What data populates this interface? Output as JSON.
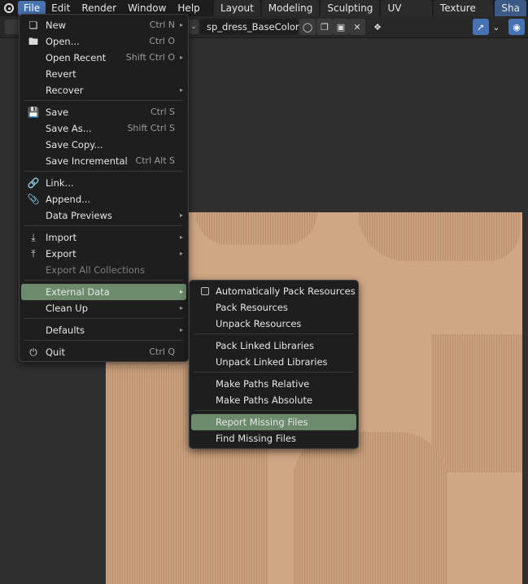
{
  "topbar": {
    "menus": [
      "File",
      "Edit",
      "Render",
      "Window",
      "Help"
    ],
    "workspaces": [
      "Layout",
      "Modeling",
      "Sculpting",
      "UV Editing",
      "Texture Paint",
      "Sha"
    ]
  },
  "header": {
    "image_name": "sp_dress_BaseColor"
  },
  "file_menu": {
    "new": {
      "label": "New",
      "shortcut": "Ctrl N"
    },
    "open": {
      "label": "Open...",
      "shortcut": "Ctrl O"
    },
    "open_recent": {
      "label": "Open Recent",
      "shortcut": "Shift Ctrl O"
    },
    "revert": {
      "label": "Revert"
    },
    "recover": {
      "label": "Recover"
    },
    "save": {
      "label": "Save",
      "shortcut": "Ctrl S"
    },
    "save_as": {
      "label": "Save As...",
      "shortcut": "Shift Ctrl S"
    },
    "save_copy": {
      "label": "Save Copy..."
    },
    "save_incremental": {
      "label": "Save Incremental",
      "shortcut": "Ctrl Alt S"
    },
    "link": {
      "label": "Link..."
    },
    "append": {
      "label": "Append..."
    },
    "data_previews": {
      "label": "Data Previews"
    },
    "import": {
      "label": "Import"
    },
    "export": {
      "label": "Export"
    },
    "export_all": {
      "label": "Export All Collections"
    },
    "external_data": {
      "label": "External Data"
    },
    "clean_up": {
      "label": "Clean Up"
    },
    "defaults": {
      "label": "Defaults"
    },
    "quit": {
      "label": "Quit",
      "shortcut": "Ctrl Q"
    }
  },
  "external_data_menu": {
    "auto_pack": {
      "label": "Automatically Pack Resources",
      "checked": false
    },
    "pack_resources": {
      "label": "Pack Resources"
    },
    "unpack_resources": {
      "label": "Unpack Resources"
    },
    "pack_linked": {
      "label": "Pack Linked Libraries"
    },
    "unpack_linked": {
      "label": "Unpack Linked Libraries"
    },
    "paths_relative": {
      "label": "Make Paths Relative"
    },
    "paths_absolute": {
      "label": "Make Paths Absolute"
    },
    "report_missing": {
      "label": "Report Missing Files"
    },
    "find_missing": {
      "label": "Find Missing Files"
    }
  },
  "colors": {
    "accent": "#4772b3",
    "menu_highlight": "#6c8a6c",
    "menu_bg": "#1e1e1e",
    "texture": "#d0a785"
  }
}
